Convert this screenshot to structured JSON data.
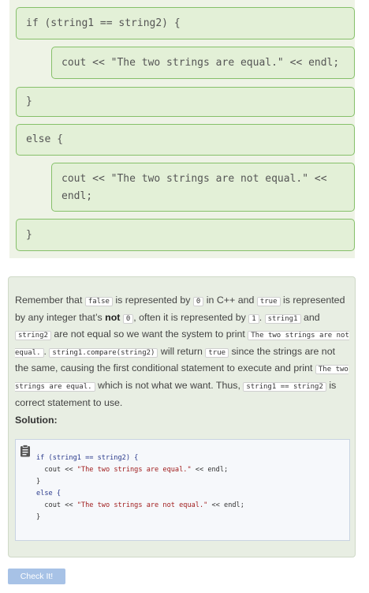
{
  "blocks": [
    "if (string1 == string2) {",
    "cout << \"The two strings are equal.\" << endl;",
    "}",
    "else {",
    "cout << \"The two strings are not equal.\" << endl;",
    "}"
  ],
  "explanation": {
    "t1": "Remember that ",
    "c1": "false",
    "t2": " is represented by ",
    "c2": "0",
    "t3": " in C++ and ",
    "c3": "true",
    "t4": " is represented by any integer that’s ",
    "bold": "not",
    "t5": " ",
    "c4": "0",
    "t6": ", often it is represented by ",
    "c5": "1",
    "t7": ". ",
    "c6": "string1",
    "t8": " and ",
    "c7": "string2",
    "t9": " are not equal so we want the system to print ",
    "c8": "The two strings are not equal.",
    "t10": ". ",
    "c9": "string1.compare(string2)",
    "t11": " will return ",
    "c10": "true",
    "t12": " since the strings are not the same, causing the first conditional statement to execute and print ",
    "c11": "The two strings are equal.",
    "t13": " which is not what we want. Thus, ",
    "c12": "string1 == string2",
    "t14": " is correct statement to use."
  },
  "solution": {
    "title": "Solution:",
    "code": {
      "l1": "if (string1 == string2) {",
      "l2a": "  cout << ",
      "l2s": "\"The two strings are equal.\"",
      "l2b": " << endl;",
      "l3": "}",
      "l4": "else {",
      "l5a": "  cout << ",
      "l5s": "\"The two strings are not equal.\"",
      "l5b": " << endl;",
      "l6": "}"
    }
  },
  "check_button": "Check It!"
}
